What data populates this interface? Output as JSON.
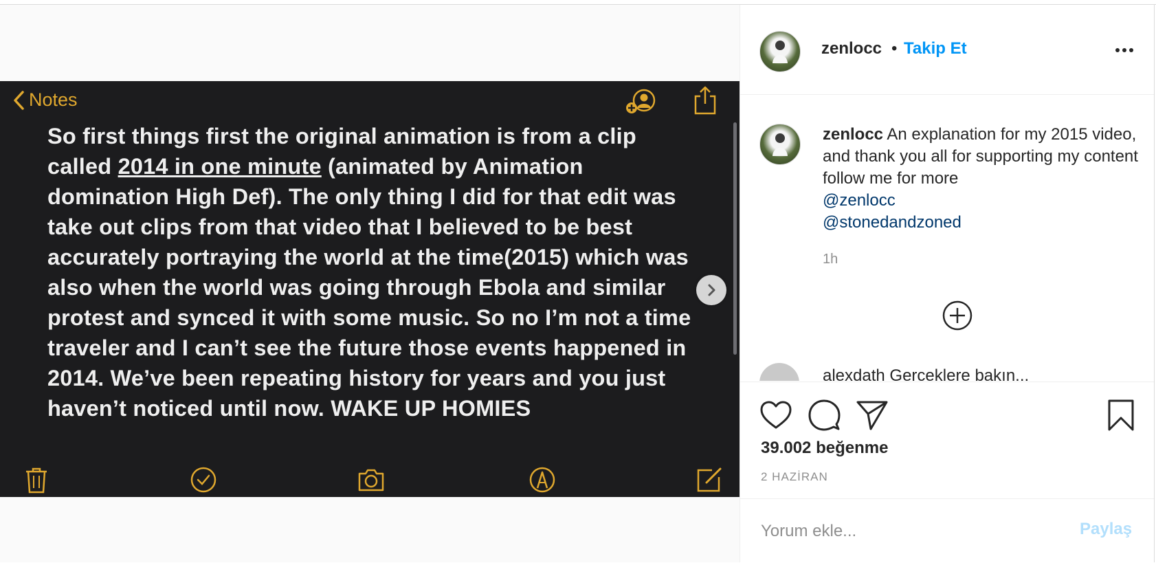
{
  "note": {
    "back_label": "Notes",
    "text_before_link": "So first things first the original animation is from a clip called ",
    "link_text": "2014 in one minute",
    "text_after_link": " (animated by Animation domination High Def). The only thing I did  for that edit was take out clips from that video that I believed to be best accurately portraying the world at the time(2015) which was also when the world was going through Ebola and similar protest and synced it with some music. So no I’m not a time traveler and I can’t see the future those events happened in 2014. We’ve been repeating history for years and you just haven’t noticed until now. WAKE UP HOMIES"
  },
  "header": {
    "username": "zenlocc",
    "separator": "•",
    "follow_label": "Takip Et"
  },
  "caption": {
    "username": "zenlocc",
    "text": "An explanation for my 2015 video, and thank you all for supporting my content follow me for more",
    "mentions": [
      "@zenlocc",
      "@stonedandzoned"
    ],
    "time": "1h"
  },
  "next_comment": {
    "text": "alexdath Gerceklere bakın..."
  },
  "post": {
    "likes": "39.002 beğenme",
    "date": "2 HAZİRAN"
  },
  "comment": {
    "placeholder": "Yorum ekle...",
    "post_label": "Paylaş"
  },
  "colors": {
    "accent": "#0095f6",
    "note_yellow": "#e0a82e",
    "note_background": "#1c1c1e"
  },
  "icons": [
    "chevron-left-icon",
    "add-person-icon",
    "share-icon",
    "chevron-right-icon",
    "trash-icon",
    "checkmark-icon",
    "camera-icon",
    "markup-icon",
    "compose-icon",
    "more-options-icon",
    "add-circle-icon",
    "heart-icon",
    "comment-icon",
    "send-icon",
    "bookmark-icon"
  ]
}
